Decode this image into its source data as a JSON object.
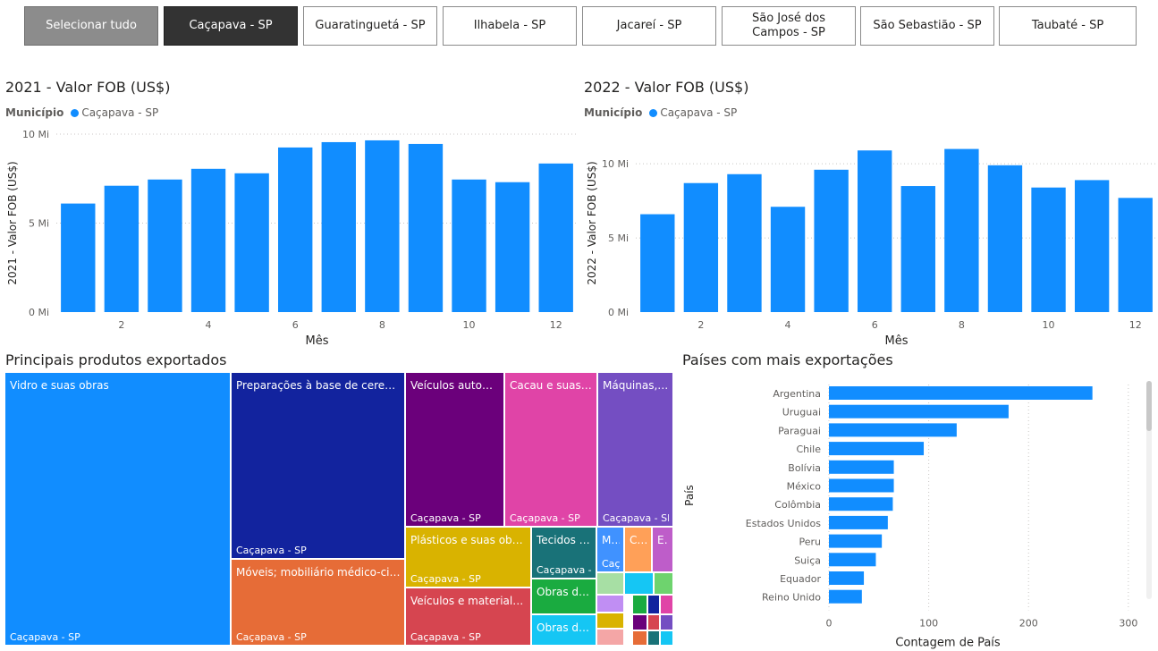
{
  "slicer": {
    "buttons": [
      {
        "label": "Selecionar tudo",
        "state": "all"
      },
      {
        "label": "Caçapava - SP",
        "state": "selected"
      },
      {
        "label": "Guaratinguetá - SP",
        "state": ""
      },
      {
        "label": "Ilhabela - SP",
        "state": ""
      },
      {
        "label": "Jacareí - SP",
        "state": ""
      },
      {
        "label": "São José dos Campos - SP",
        "state": ""
      },
      {
        "label": "São Sebastião - SP",
        "state": ""
      },
      {
        "label": "Taubaté - SP",
        "state": ""
      }
    ]
  },
  "colors": {
    "accent": "#118dff",
    "slicer_all": "#8c8c8c",
    "slicer_selected": "#333333"
  },
  "chart2021": {
    "title": "2021 - Valor FOB (US$)",
    "legend_label": "Município",
    "legend_item": "Caçapava - SP"
  },
  "chart2022": {
    "title": "2022 - Valor FOB (US$)",
    "legend_label": "Município",
    "legend_item": "Caçapava - SP"
  },
  "treemap": {
    "title": "Principais produtos exportados",
    "items": [
      {
        "label": "Vidro e suas obras",
        "sub": "Caçapava - SP",
        "color": "#118dff"
      },
      {
        "label": "Preparações à base de cereais, farinhas, amidos, féculas ou leite",
        "sub": "Caçapava - SP",
        "color": "#12239e"
      },
      {
        "label": "Móveis; mobiliário médico-cirúrgico",
        "sub": "Caçapava - SP",
        "color": "#e66c37"
      },
      {
        "label": "Veículos automóveis, tratores",
        "sub": "Caçapava - SP",
        "color": "#6b007b"
      },
      {
        "label": "Cacau e suas preparações",
        "sub": "Caçapava - SP",
        "color": "#e044a7"
      },
      {
        "label": "Máquinas, aparelhos e materiais elétricos",
        "sub": "Caçapava - SP",
        "color": "#744ec2"
      },
      {
        "label": "Plásticos e suas obras",
        "sub": "Caçapava - SP",
        "color": "#d9b300"
      },
      {
        "label": "Veículos e material para vias férreas",
        "sub": "Caçapava - SP",
        "color": "#d64550"
      },
      {
        "label": "Tecidos especiais",
        "sub": "Caçapava - SP",
        "color": "#197278"
      },
      {
        "label": "Obras de ferro ou aço",
        "sub": "",
        "color": "#1aab40"
      },
      {
        "label": "Obras diversas",
        "sub": "",
        "color": "#15c6f4"
      },
      {
        "label": "Matérias plásticas",
        "sub": "Caçapava - SP",
        "color": "#4092ff"
      },
      {
        "label": "Calçados",
        "sub": "",
        "color": "#ffa058"
      },
      {
        "label": "Extratos tanantes",
        "sub": "",
        "color": "#be5dc9"
      }
    ]
  },
  "bar_chart": {
    "title": "Países com mais exportações"
  },
  "chart_data": [
    {
      "type": "bar",
      "title": "2021 - Valor FOB (US$)",
      "xlabel": "Mês",
      "ylabel": "2021 - Valor FOB (US$)",
      "categories": [
        1,
        2,
        3,
        4,
        5,
        6,
        7,
        8,
        9,
        10,
        11,
        12
      ],
      "x_ticks": [
        "2",
        "4",
        "6",
        "8",
        "10",
        "12"
      ],
      "y_ticks": [
        "0 Mi",
        "5 Mi",
        "10 Mi"
      ],
      "ylim": [
        0,
        10000000
      ],
      "series": [
        {
          "name": "Caçapava - SP",
          "values": [
            6100000,
            7100000,
            7450000,
            8050000,
            7800000,
            9250000,
            9550000,
            9650000,
            9450000,
            7450000,
            7300000,
            8350000
          ]
        }
      ],
      "grid": true
    },
    {
      "type": "bar",
      "title": "2022 - Valor FOB (US$)",
      "xlabel": "Mês",
      "ylabel": "2022 - Valor FOB (US$)",
      "categories": [
        1,
        2,
        3,
        4,
        5,
        6,
        7,
        8,
        9,
        10,
        11,
        12
      ],
      "x_ticks": [
        "2",
        "4",
        "6",
        "8",
        "10",
        "12"
      ],
      "y_ticks": [
        "0 Mi",
        "5 Mi",
        "10 Mi"
      ],
      "ylim": [
        0,
        12000000
      ],
      "series": [
        {
          "name": "Caçapava - SP",
          "values": [
            6600000,
            8700000,
            9300000,
            7100000,
            9600000,
            10900000,
            8500000,
            11000000,
            9900000,
            8400000,
            8900000,
            7700000
          ]
        }
      ],
      "grid": true
    },
    {
      "type": "bar",
      "orientation": "horizontal",
      "title": "Países com mais exportações",
      "xlabel": "Contagem de País",
      "ylabel": "País",
      "categories": [
        "Argentina",
        "Uruguai",
        "Paraguai",
        "Chile",
        "Bolívia",
        "México",
        "Colômbia",
        "Estados Unidos",
        "Peru",
        "Suiça",
        "Equador",
        "Reino Unido"
      ],
      "values": [
        264,
        180,
        128,
        95,
        65,
        65,
        64,
        59,
        53,
        47,
        35,
        33
      ],
      "x_ticks": [
        "0",
        "100",
        "200",
        "300"
      ],
      "xlim": [
        0,
        310
      ],
      "grid": true
    }
  ]
}
